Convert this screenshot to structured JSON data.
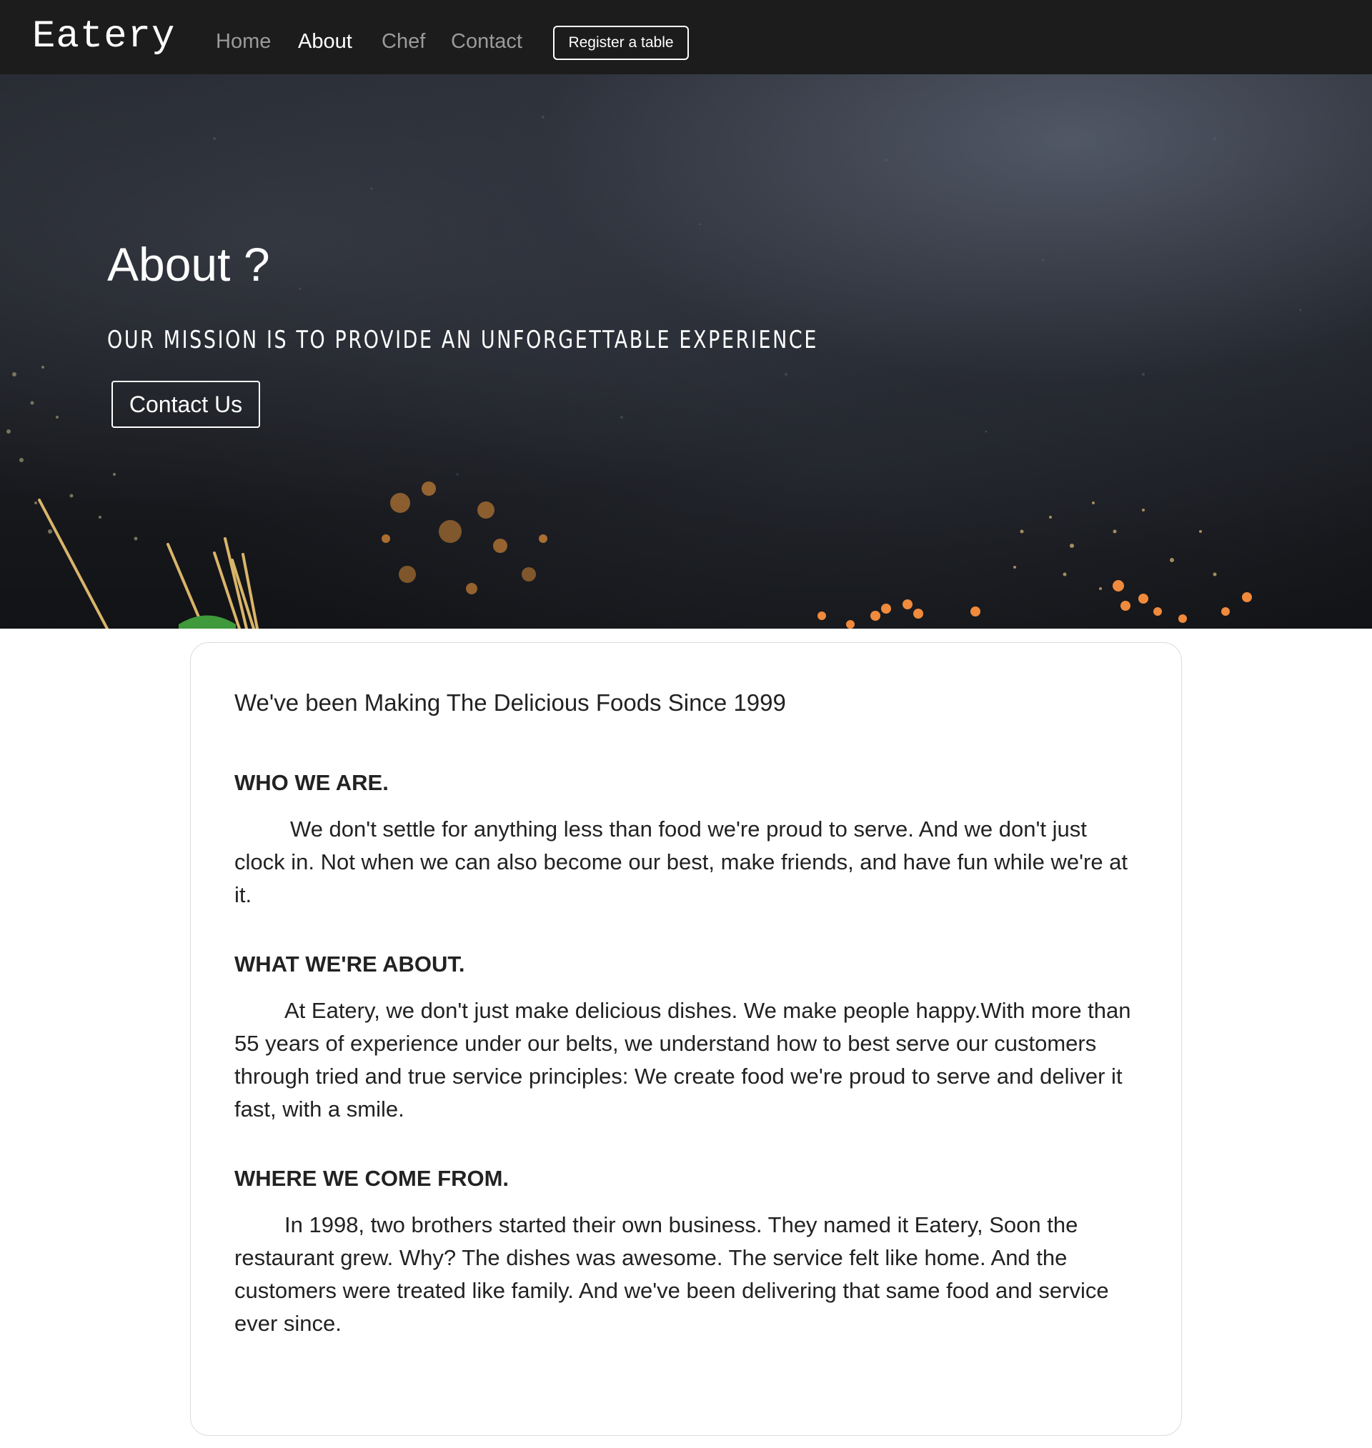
{
  "navbar": {
    "brand": "Eatery",
    "links": [
      {
        "label": "Home",
        "active": false
      },
      {
        "label": "About",
        "active": true
      },
      {
        "label": "Chef",
        "active": false
      },
      {
        "label": "Contact",
        "active": false
      }
    ],
    "register_label": "Register a table"
  },
  "hero": {
    "title": "About ?",
    "subtitle": "OUR MISSION IS TO PROVIDE AN UNFORGETTABLE EXPERIENCE",
    "button_label": "Contact Us"
  },
  "content": {
    "tagline": "We've been Making The Delicious Foods Since 1999",
    "sections": [
      {
        "heading": "WHO WE ARE.",
        "body": "We don't settle for anything less than food we're proud to serve. And we don't just clock in. Not when we can also become our best, make friends, and have fun while we're at it."
      },
      {
        "heading": "WHAT WE'RE ABOUT.",
        "body": "At Eatery, we don't just make delicious dishes. We make people happy.With more than 55 years of experience under our belts, we understand how to best serve our customers through tried and true service principles: We create food we're proud to serve and deliver it fast, with a smile."
      },
      {
        "heading": "WHERE WE COME FROM.",
        "body": "In 1998, two brothers started their own business. They named it Eatery, Soon the restaurant grew. Why? The dishes was awesome. The service felt like home. And the customers were treated like family. And we've been delivering that same food and service ever since."
      }
    ]
  },
  "colors": {
    "navbar_bg": "#1c1c1c",
    "nav_inactive": "#9b9b9b",
    "nav_active": "#ffffff",
    "hero_bg": "#1b1d22",
    "spice_orange": "#e8933a",
    "card_border": "#dcdcdc"
  }
}
